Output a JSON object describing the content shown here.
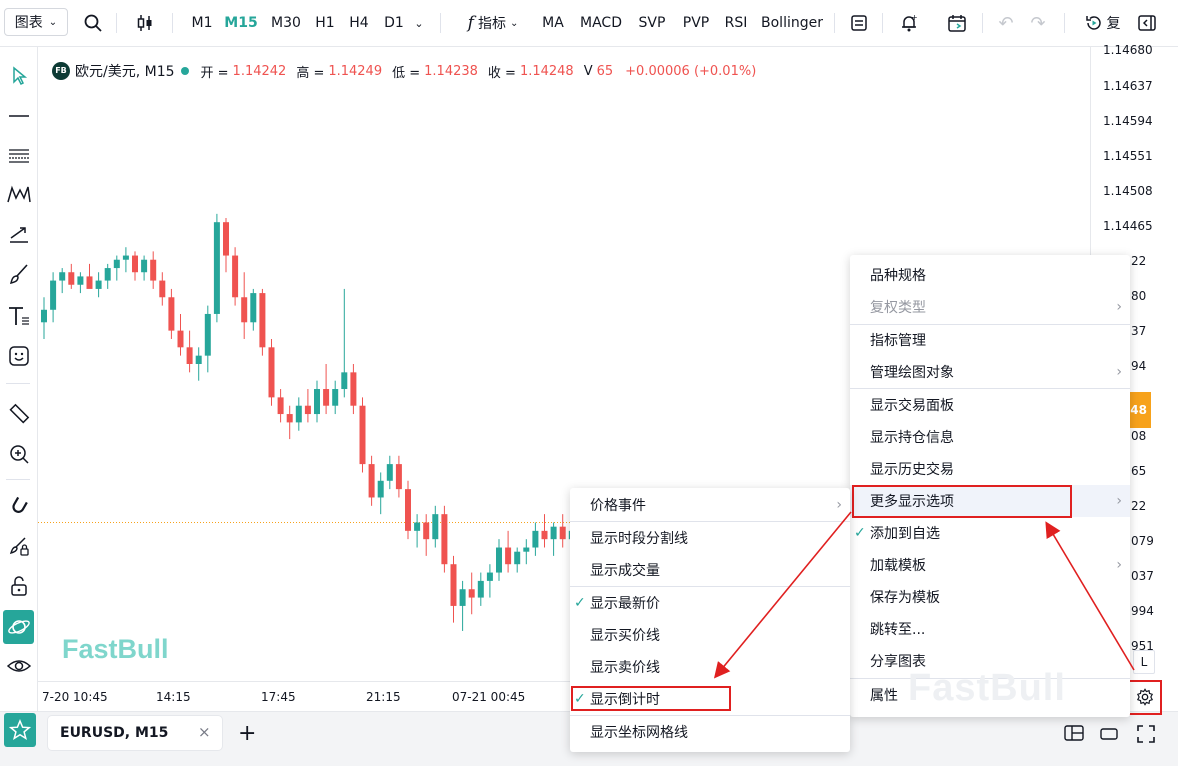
{
  "toolbar": {
    "chart_menu": "图表",
    "timeframes": [
      "M1",
      "M15",
      "M30",
      "H1",
      "H4",
      "D1"
    ],
    "active_timeframe": "M15",
    "indicators_label": "指标",
    "indicators": [
      "MA",
      "MACD",
      "SVP",
      "PVP",
      "RSI",
      "Bollinger"
    ],
    "replay_label": "复"
  },
  "legend": {
    "badge": "FB",
    "symbol": "欧元/美元, M15",
    "open_label": "开 =",
    "open": "1.14242",
    "high_label": "高 =",
    "high": "1.14249",
    "low_label": "低 =",
    "low": "1.14238",
    "close_label": "收 =",
    "close": "1.14248",
    "volume_label": "V",
    "volume": "65",
    "change": "+0.00006 (+0.01%)"
  },
  "price_axis": {
    "ticks": [
      "1.14680",
      "1.14637",
      "1.14594",
      "1.14551",
      "1.14508",
      "1.14465",
      "22",
      "80",
      "37",
      "94",
      "08",
      "65",
      "22",
      "079",
      "037",
      "994",
      "951"
    ],
    "current_price": "248",
    "scale_mode": "L"
  },
  "time_axis": {
    "ticks": [
      "7-20 10:45",
      "14:15",
      "17:45",
      "21:15",
      "07-21 00:45"
    ]
  },
  "watermark": "FastBull",
  "bottom": {
    "tab_label": "EURUSD, M15"
  },
  "context_menu": {
    "items": [
      {
        "label": "品种规格"
      },
      {
        "label": "复权类型",
        "disabled": true,
        "submenu": true
      },
      {
        "label": "指标管理"
      },
      {
        "label": "管理绘图对象",
        "submenu": true
      },
      {
        "label": "显示交易面板"
      },
      {
        "label": "显示持仓信息"
      },
      {
        "label": "显示历史交易"
      },
      {
        "label": "更多显示选项",
        "submenu": true,
        "highlighted": true
      },
      {
        "label": "添加到自选",
        "checked": true
      },
      {
        "label": "加载模板",
        "submenu": true
      },
      {
        "label": "保存为模板"
      },
      {
        "label": "跳转至..."
      },
      {
        "label": "分享图表"
      },
      {
        "label": "属性"
      }
    ]
  },
  "submenu": {
    "items": [
      {
        "label": "价格事件",
        "submenu": true
      },
      {
        "label": "显示时段分割线"
      },
      {
        "label": "显示成交量"
      },
      {
        "label": "显示最新价",
        "checked": true
      },
      {
        "label": "显示买价线"
      },
      {
        "label": "显示卖价线"
      },
      {
        "label": "显示倒计时",
        "checked": true,
        "highlighted": true
      },
      {
        "label": "显示坐标网格线"
      }
    ]
  },
  "colors": {
    "up": "#26a69a",
    "down": "#ef5350",
    "accent": "#26a69a",
    "highlight": "#e02020",
    "price_label": "#f7a21b"
  },
  "chart_data": {
    "type": "candlestick",
    "symbol": "EURUSD",
    "timeframe": "M15",
    "ylim": [
      1.1393,
      1.1469
    ],
    "x_ticks": [
      "7-20 10:45",
      "14:15",
      "17:45",
      "21:15",
      "07-21 00:45"
    ],
    "ohlc": [
      [
        1.1436,
        1.1439,
        1.1434,
        1.14375
      ],
      [
        1.14375,
        1.1442,
        1.1436,
        1.1441
      ],
      [
        1.1441,
        1.14425,
        1.14395,
        1.1442
      ],
      [
        1.1442,
        1.1443,
        1.144,
        1.14405
      ],
      [
        1.14405,
        1.1442,
        1.14395,
        1.14415
      ],
      [
        1.14415,
        1.1443,
        1.14405,
        1.144
      ],
      [
        1.144,
        1.1442,
        1.1439,
        1.1441
      ],
      [
        1.1441,
        1.1443,
        1.144,
        1.14425
      ],
      [
        1.14425,
        1.1444,
        1.1441,
        1.14435
      ],
      [
        1.14435,
        1.1445,
        1.1442,
        1.1444
      ],
      [
        1.1444,
        1.14445,
        1.1441,
        1.1442
      ],
      [
        1.1442,
        1.1444,
        1.1441,
        1.14435
      ],
      [
        1.14435,
        1.14445,
        1.144,
        1.1441
      ],
      [
        1.1441,
        1.1442,
        1.1438,
        1.1439
      ],
      [
        1.1439,
        1.144,
        1.1434,
        1.1435
      ],
      [
        1.1435,
        1.1437,
        1.1432,
        1.1433
      ],
      [
        1.1433,
        1.1435,
        1.143,
        1.1431
      ],
      [
        1.1431,
        1.1433,
        1.1429,
        1.1432
      ],
      [
        1.1432,
        1.1438,
        1.143,
        1.1437
      ],
      [
        1.1437,
        1.1449,
        1.1436,
        1.1448
      ],
      [
        1.1448,
        1.14485,
        1.1442,
        1.1444
      ],
      [
        1.1444,
        1.1445,
        1.1438,
        1.1439
      ],
      [
        1.1439,
        1.1442,
        1.1434,
        1.1436
      ],
      [
        1.1436,
        1.144,
        1.1435,
        1.14395
      ],
      [
        1.14395,
        1.144,
        1.1432,
        1.1433
      ],
      [
        1.1433,
        1.1434,
        1.1426,
        1.1427
      ],
      [
        1.1427,
        1.1428,
        1.1424,
        1.1425
      ],
      [
        1.1425,
        1.1426,
        1.1422,
        1.1424
      ],
      [
        1.1424,
        1.1427,
        1.1423,
        1.1426
      ],
      [
        1.1426,
        1.1428,
        1.1424,
        1.1425
      ],
      [
        1.1425,
        1.1429,
        1.1424,
        1.1428
      ],
      [
        1.1428,
        1.1431,
        1.1425,
        1.1426
      ],
      [
        1.1426,
        1.1429,
        1.1425,
        1.1428
      ],
      [
        1.1428,
        1.144,
        1.1427,
        1.143
      ],
      [
        1.143,
        1.1431,
        1.1425,
        1.1426
      ],
      [
        1.1426,
        1.1427,
        1.1418,
        1.1419
      ],
      [
        1.1419,
        1.142,
        1.1414,
        1.1415
      ],
      [
        1.1415,
        1.1418,
        1.1413,
        1.1417
      ],
      [
        1.1417,
        1.142,
        1.1416,
        1.1419
      ],
      [
        1.1419,
        1.142,
        1.1415,
        1.1416
      ],
      [
        1.1416,
        1.1417,
        1.141,
        1.1411
      ],
      [
        1.1411,
        1.1413,
        1.1409,
        1.1412
      ],
      [
        1.1412,
        1.1413,
        1.1408,
        1.141
      ],
      [
        1.141,
        1.1414,
        1.1409,
        1.1413
      ],
      [
        1.1413,
        1.1414,
        1.1406,
        1.1407
      ],
      [
        1.1407,
        1.1408,
        1.14,
        1.1402
      ],
      [
        1.1402,
        1.1405,
        1.1399,
        1.1404
      ],
      [
        1.1404,
        1.1406,
        1.1401,
        1.1403
      ],
      [
        1.1403,
        1.1406,
        1.1402,
        1.1405
      ],
      [
        1.1405,
        1.1407,
        1.1403,
        1.1406
      ],
      [
        1.1406,
        1.141,
        1.1405,
        1.1409
      ],
      [
        1.1409,
        1.1411,
        1.1406,
        1.1407
      ],
      [
        1.1407,
        1.1409,
        1.1406,
        1.14085
      ],
      [
        1.14085,
        1.141,
        1.1407,
        1.1409
      ],
      [
        1.1409,
        1.1412,
        1.1408,
        1.1411
      ],
      [
        1.1411,
        1.1413,
        1.1409,
        1.141
      ],
      [
        1.141,
        1.1412,
        1.1408,
        1.14115
      ],
      [
        1.14115,
        1.1413,
        1.1409,
        1.141
      ],
      [
        1.141,
        1.1412,
        1.1408,
        1.1411
      ],
      [
        1.1411,
        1.1413,
        1.14095,
        1.1412
      ]
    ]
  }
}
